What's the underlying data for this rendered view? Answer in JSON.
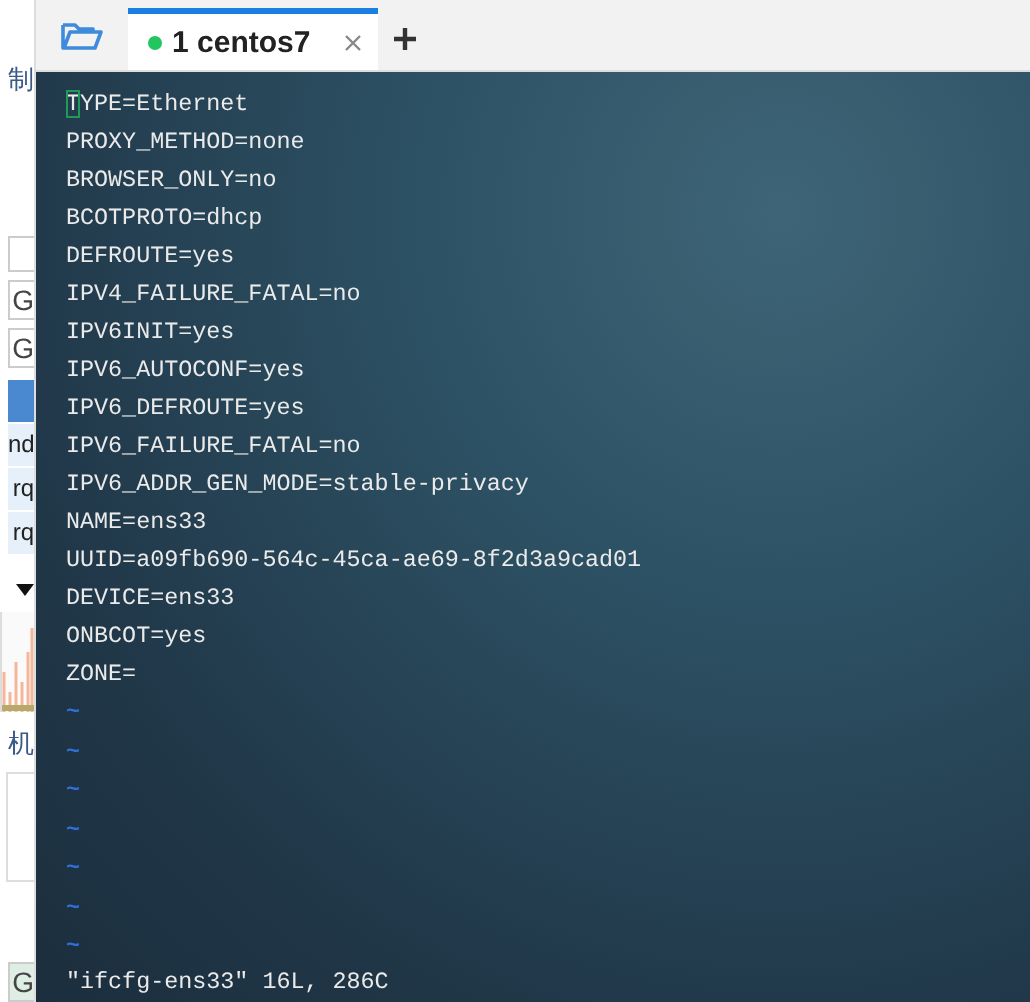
{
  "side_panel": {
    "items": [
      {
        "kind": "label",
        "text": "制"
      },
      {
        "kind": "field"
      },
      {
        "kind": "field",
        "text": "G"
      },
      {
        "kind": "field",
        "text": "G"
      },
      {
        "kind": "row",
        "selected": true
      },
      {
        "kind": "row",
        "text": "nd",
        "selected": false
      },
      {
        "kind": "row",
        "text": "rq",
        "selected": false
      },
      {
        "kind": "row",
        "text": "rq",
        "selected": false
      },
      {
        "kind": "caret"
      },
      {
        "kind": "chart"
      },
      {
        "kind": "label",
        "text": "机"
      },
      {
        "kind": "panel"
      },
      {
        "kind": "field",
        "text": "G"
      }
    ]
  },
  "tabs": {
    "items": [
      {
        "label": "1 centos7",
        "selected": true,
        "color": "#22c55e"
      }
    ]
  },
  "terminal": {
    "lines": [
      {
        "text": "TYPE=Ethernet",
        "cursor": true
      },
      {
        "text": "PROXY_METHOD=none",
        "cursor": false
      },
      {
        "text": "BROWSER_ONLY=no",
        "cursor": false
      },
      {
        "text": "BCOTPROTO=dhcp",
        "cursor": false
      },
      {
        "text": "DEFROUTE=yes",
        "cursor": false
      },
      {
        "text": "IPV4_FAILURE_FATAL=no",
        "cursor": false
      },
      {
        "text": "IPV6INIT=yes",
        "cursor": false
      },
      {
        "text": "IPV6_AUTOCONF=yes",
        "cursor": false
      },
      {
        "text": "IPV6_DEFROUTE=yes",
        "cursor": false
      },
      {
        "text": "IPV6_FAILURE_FATAL=no",
        "cursor": false
      },
      {
        "text": "IPV6_ADDR_GEN_MODE=stable-privacy",
        "cursor": false
      },
      {
        "text": "NAME=ens33",
        "cursor": false
      },
      {
        "text": "UUID=a09fb690-564c-45ca-ae69-8f2d3a9cad01",
        "cursor": false
      },
      {
        "text": "DEVICE=ens33",
        "cursor": false
      },
      {
        "text": "ONBCOT=yes",
        "cursor": false
      },
      {
        "text": "ZONE=",
        "cursor": false
      }
    ],
    "empty_lines": [
      "~",
      "~",
      "~",
      "~",
      "~",
      "~",
      "~"
    ],
    "message": "\"ifcfg-ens33\" 16L, 286C"
  }
}
